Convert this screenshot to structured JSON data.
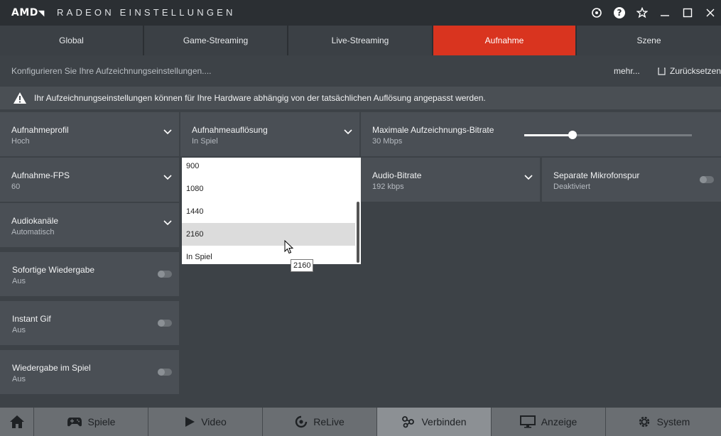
{
  "window": {
    "logo": "AMD",
    "title": "RADEON EINSTELLUNGEN"
  },
  "tabs": [
    {
      "label": "Global"
    },
    {
      "label": "Game-Streaming"
    },
    {
      "label": "Live-Streaming"
    },
    {
      "label": "Aufnahme",
      "active": true
    },
    {
      "label": "Szene"
    }
  ],
  "info": {
    "text": "Konfigurieren Sie Ihre Aufzeichnungseinstellungen....",
    "more": "mehr...",
    "reset": "Zurücksetzen"
  },
  "warning": {
    "text": "Ihr Aufzeichnungseinstellungen können für Ihre Hardware abhängig von der tatsächlichen Auflösung angepasst werden."
  },
  "settings": {
    "profile": {
      "label": "Aufnahmeprofil",
      "value": "Hoch"
    },
    "resolution": {
      "label": "Aufnahmeauflösung",
      "value": "In Spiel"
    },
    "bitrate": {
      "label": "Maximale Aufzeichnungs-Bitrate",
      "value": "30 Mbps",
      "slider_level": 0.29
    },
    "fps": {
      "label": "Aufnahme-FPS",
      "value": "60"
    },
    "audio_bitrate": {
      "label": "Audio-Bitrate",
      "value": "192 kbps"
    },
    "mic_track": {
      "label": "Separate Mikrofonspur",
      "value": "Deaktiviert",
      "enabled": false
    },
    "audio_channels": {
      "label": "Audiokanäle",
      "value": "Automatisch"
    },
    "instant_replay": {
      "label": "Sofortige Wiedergabe",
      "value": "Aus",
      "enabled": false
    },
    "instant_gif": {
      "label": "Instant Gif",
      "value": "Aus",
      "enabled": false
    },
    "ingame_replay": {
      "label": "Wiedergabe im Spiel",
      "value": "Aus",
      "enabled": false
    }
  },
  "resolution_dropdown": {
    "options": [
      "900",
      "1080",
      "1440",
      "2160",
      "In Spiel"
    ],
    "hovered": "2160",
    "tooltip": "2160"
  },
  "bottom_nav": {
    "home_icon": "home-icon",
    "items": [
      {
        "label": "Spiele",
        "icon": "gamepad-icon"
      },
      {
        "label": "Video",
        "icon": "play-icon"
      },
      {
        "label": "ReLive",
        "icon": "relive-icon"
      },
      {
        "label": "Verbinden",
        "icon": "connect-icon",
        "active": true
      },
      {
        "label": "Anzeige",
        "icon": "monitor-icon"
      },
      {
        "label": "System",
        "icon": "gear-icon"
      }
    ]
  },
  "colors": {
    "accent": "#d9341f",
    "tile": "#4a4f55",
    "background": "#3d4247"
  }
}
